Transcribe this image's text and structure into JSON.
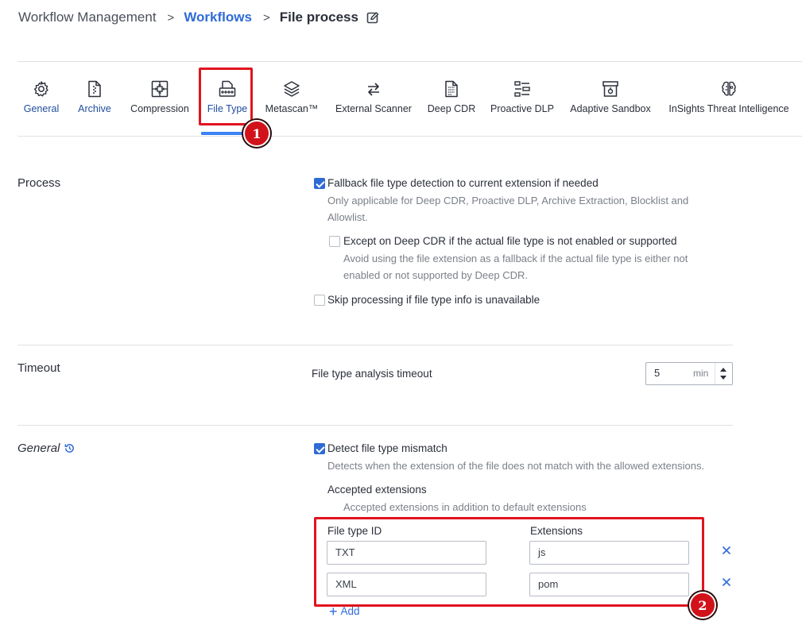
{
  "breadcrumb": {
    "root": "Workflow Management",
    "parent": "Workflows",
    "current": "File process",
    "separator": ">"
  },
  "tabs": [
    {
      "label": "General",
      "icon": "gear-icon"
    },
    {
      "label": "Archive",
      "icon": "archive-file-icon"
    },
    {
      "label": "Compression",
      "icon": "compression-icon"
    },
    {
      "label": "File Type",
      "icon": "file-type-icon",
      "active": true
    },
    {
      "label": "Metascan™",
      "icon": "layers-icon"
    },
    {
      "label": "External Scanner",
      "icon": "swap-arrows-icon"
    },
    {
      "label": "Deep CDR",
      "icon": "deep-cdr-icon"
    },
    {
      "label": "Proactive DLP",
      "icon": "dlp-icon"
    },
    {
      "label": "Adaptive Sandbox",
      "icon": "sandbox-icon"
    },
    {
      "label": "InSights Threat Intelligence",
      "icon": "brain-icon"
    }
  ],
  "annotations": {
    "badge1": "1",
    "badge2": "2"
  },
  "process": {
    "title": "Process",
    "fallback": {
      "label": "Fallback file type detection to current extension if needed",
      "checked": true,
      "desc_line1": "Only applicable for Deep CDR, Proactive DLP, Archive Extraction, Blocklist and",
      "desc_line2": "Allowlist."
    },
    "except": {
      "label": "Except on Deep CDR if the actual file type is not enabled or supported",
      "checked": false,
      "desc_line1": "Avoid using the file extension as a fallback if the actual file type is either not",
      "desc_line2": "enabled or not supported by Deep CDR."
    },
    "skip": {
      "label": "Skip processing if file type info is unavailable",
      "checked": false
    }
  },
  "timeout": {
    "title": "Timeout",
    "label": "File type analysis timeout",
    "value": "5",
    "unit": "min"
  },
  "general": {
    "title": "General",
    "detect": {
      "label": "Detect file type mismatch",
      "checked": true,
      "desc": "Detects when the extension of the file does not match with the allowed extensions."
    },
    "accepted_title": "Accepted extensions",
    "accepted_desc": "Accepted extensions in addition to default extensions",
    "col_file_type": "File type ID",
    "col_extensions": "Extensions",
    "rows": [
      {
        "file_type": "TXT",
        "extension": "js"
      },
      {
        "file_type": "XML",
        "extension": "pom"
      }
    ],
    "add_label": "Add"
  },
  "colors": {
    "accent": "#2f6bd6",
    "highlight": "#e0141e",
    "tab_underline": "#3b82f6"
  }
}
